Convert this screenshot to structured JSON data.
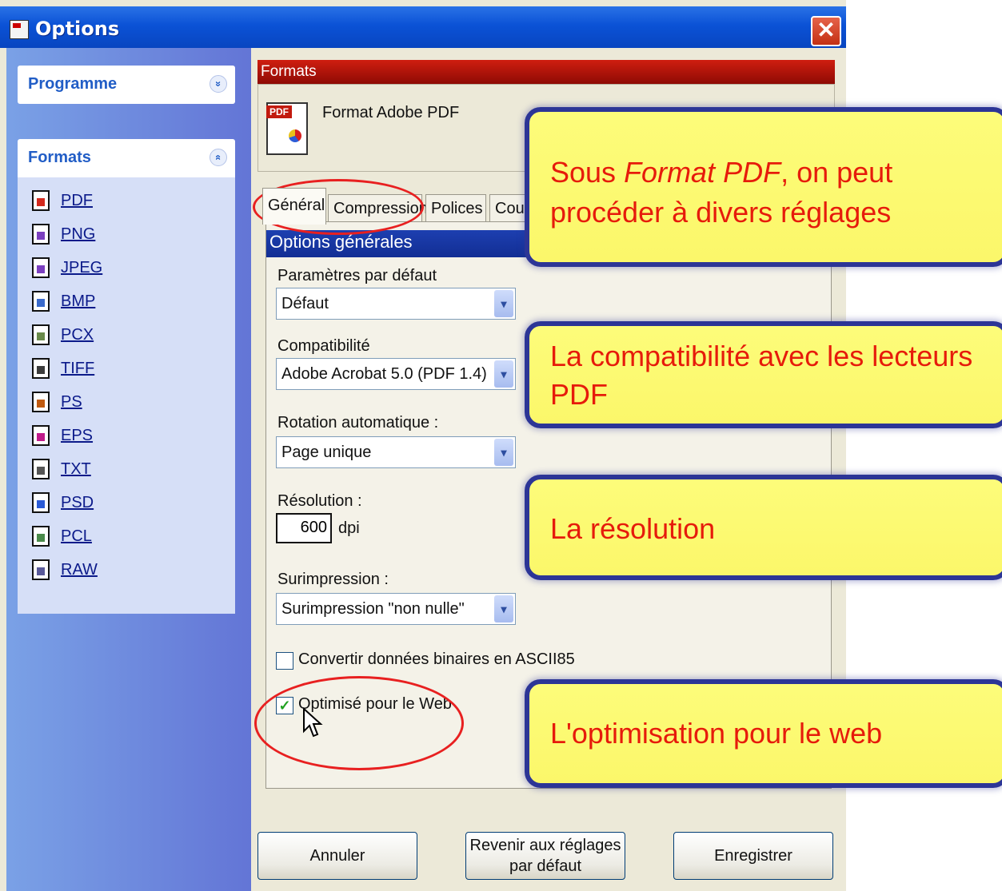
{
  "window": {
    "title": "Options",
    "close_glyph": "✕"
  },
  "sidebar": {
    "programme": {
      "label": "Programme",
      "chevron": "»"
    },
    "formats": {
      "label": "Formats",
      "chevron": "«"
    },
    "items": [
      {
        "label": "PDF",
        "color": "#d32a1e"
      },
      {
        "label": "PNG",
        "color": "#7b3fbf"
      },
      {
        "label": "JPEG",
        "color": "#7b3fbf"
      },
      {
        "label": "BMP",
        "color": "#3a6acb"
      },
      {
        "label": "PCX",
        "color": "#6a8a4a"
      },
      {
        "label": "TIFF",
        "color": "#3c3c3c"
      },
      {
        "label": "PS",
        "color": "#c05a10"
      },
      {
        "label": "EPS",
        "color": "#c01a8a"
      },
      {
        "label": "TXT",
        "color": "#555555"
      },
      {
        "label": "PSD",
        "color": "#2b5bd6"
      },
      {
        "label": "PCL",
        "color": "#4a8a4a"
      },
      {
        "label": "RAW",
        "color": "#5a5a9a"
      }
    ]
  },
  "content": {
    "section_title": "Formats",
    "format_name": "Format Adobe PDF",
    "pdf_icon_tag": "PDF",
    "tabs": [
      "Général",
      "Compression",
      "Polices",
      "Coul"
    ],
    "options_title": "Options générales",
    "defaults": {
      "label": "Paramètres par défaut",
      "value": "Défaut"
    },
    "compat": {
      "label": "Compatibilité",
      "value": "Adobe Acrobat 5.0 (PDF 1.4)"
    },
    "rotation": {
      "label": "Rotation automatique :",
      "value": "Page unique"
    },
    "resolution": {
      "label": "Résolution :",
      "value": "600",
      "unit": "dpi"
    },
    "overprint": {
      "label": "Surimpression :",
      "value": "Surimpression \"non nulle\""
    },
    "ascii85": {
      "label": "Convertir données binaires en ASCII85",
      "checked": false
    },
    "web": {
      "label": "Optimisé pour le Web",
      "checked": true,
      "check_glyph": "✓"
    }
  },
  "buttons": {
    "cancel": "Annuler",
    "reset": "Revenir aux réglages\npar défaut",
    "save": "Enregistrer"
  },
  "annotations": {
    "a1": {
      "prefix": "Sous ",
      "italic": "Format PDF",
      "suffix": ", on peut",
      "line2": "procéder à divers réglages"
    },
    "a2": {
      "line1": "La compatibilité avec les lecteurs",
      "line2": "PDF"
    },
    "a3": "La résolution",
    "a4": "L'optimisation pour le web"
  },
  "colors": {
    "annotation_text": "#e61b0b",
    "annotation_border": "#2c3596",
    "annotation_fill": "#fbf76a",
    "highlight_ring": "#e82020"
  },
  "combo_arrow_glyph": "▾"
}
